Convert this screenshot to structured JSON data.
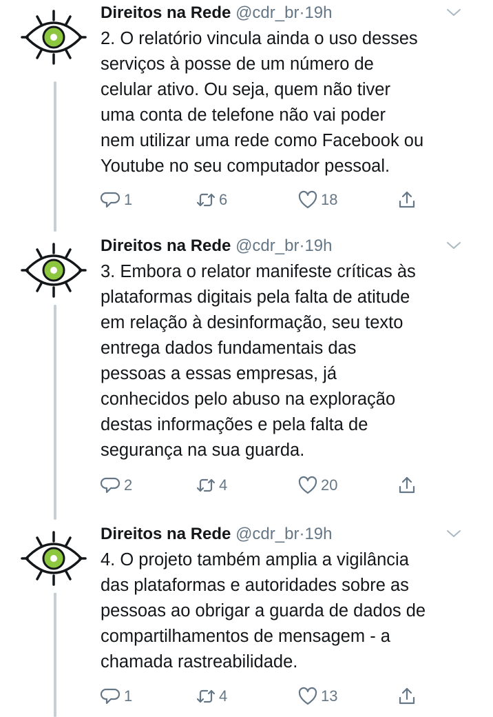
{
  "tweets": [
    {
      "display_name": "Direitos na Rede",
      "handle": "@cdr_br",
      "separator": "·",
      "time": "19h",
      "lines": [
        "2. O relatório vincula ainda o uso desses",
        "serviços à posse de um número de",
        "celular ativo. Ou seja, quem não tiver",
        "uma conta de telefone  não vai poder",
        "nem utilizar uma rede como Facebook ou",
        "Youtube no seu computador pessoal."
      ],
      "replies": "1",
      "retweets": "6",
      "likes": "18"
    },
    {
      "display_name": "Direitos na Rede",
      "handle": "@cdr_br",
      "separator": "·",
      "time": "19h",
      "lines": [
        "3. Embora o relator manifeste críticas às",
        "plataformas digitais pela falta de atitude",
        "em relação à desinformação, seu texto",
        "entrega dados fundamentais das",
        "pessoas a essas empresas, já",
        "conhecidos pelo abuso na exploração",
        "destas informações e pela falta de",
        "segurança na sua guarda."
      ],
      "replies": "2",
      "retweets": "4",
      "likes": "20"
    },
    {
      "display_name": "Direitos na Rede",
      "handle": "@cdr_br",
      "separator": "·",
      "time": "19h",
      "lines": [
        "4. O projeto também amplia a vigilância",
        "das plataformas e autoridades sobre as",
        "pessoas ao obrigar a guarda de dados de",
        "compartilhamentos de mensagem - a",
        "chamada rastreabilidade."
      ],
      "replies": "1",
      "retweets": "4",
      "likes": "13"
    }
  ],
  "colors": {
    "text": "#14171a",
    "muted": "#657786",
    "thread_line": "#c4cfd6",
    "logo_green": "#8dc63f"
  },
  "icons": {
    "avatar": "eye-logo-icon",
    "more": "chevron-down-icon",
    "reply": "reply-icon",
    "retweet": "retweet-icon",
    "like": "heart-icon",
    "share": "share-icon"
  }
}
